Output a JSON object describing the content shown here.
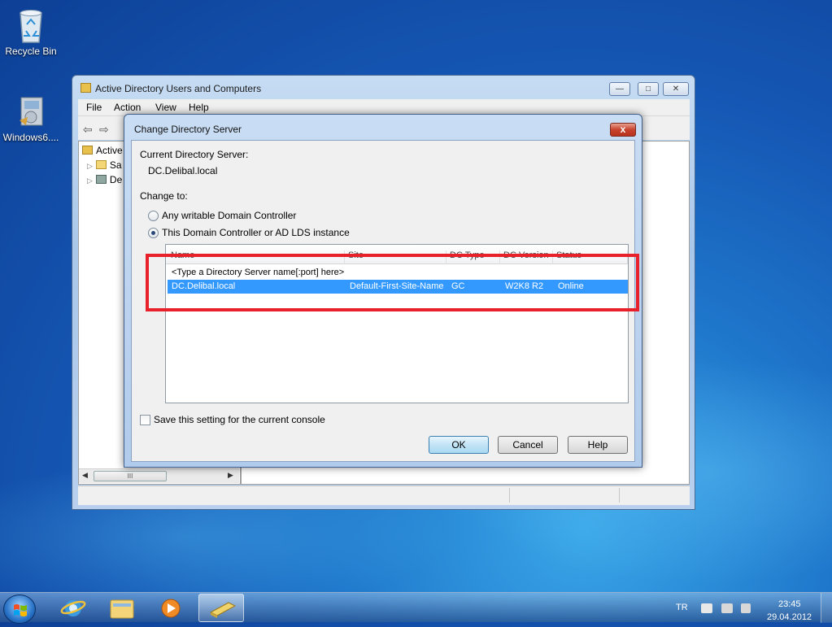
{
  "desktop": {
    "icons": [
      {
        "label": "Recycle Bin"
      },
      {
        "label": "Windows6...."
      }
    ]
  },
  "main_window": {
    "title": "Active Directory Users and Computers",
    "menu": [
      "File",
      "Action",
      "View",
      "Help"
    ],
    "tree": [
      "Active",
      "Sa",
      "De"
    ],
    "scroll_label": "III"
  },
  "dialog": {
    "title": "Change Directory Server",
    "current_label": "Current Directory Server:",
    "current_value": "DC.Delibal.local",
    "change_to_label": "Change to:",
    "options": [
      {
        "label": "Any writable Domain Controller",
        "selected": false
      },
      {
        "label": "This Domain Controller or AD LDS instance",
        "selected": true
      }
    ],
    "columns": [
      "Name",
      "Site",
      "DC Type",
      "DC Version",
      "Status"
    ],
    "rows": [
      {
        "name": "<Type a Directory Server name[:port] here>",
        "site": "",
        "dc_type": "",
        "dc_version": "",
        "status": "",
        "selected": false
      },
      {
        "name": "DC.Delibal.local",
        "site": "Default-First-Site-Name",
        "dc_type": "GC",
        "dc_version": "W2K8 R2",
        "status": "Online",
        "selected": true
      }
    ],
    "save_setting_label": "Save this setting for the current console",
    "save_setting_checked": false,
    "buttons": {
      "ok": "OK",
      "cancel": "Cancel",
      "help": "Help"
    },
    "close_glyph": "x"
  },
  "taskbar": {
    "language": "TR",
    "time": "23:45",
    "date": "29.04.2012"
  },
  "colors": {
    "highlight_box": "#e8202a",
    "selection": "#3399ff"
  }
}
